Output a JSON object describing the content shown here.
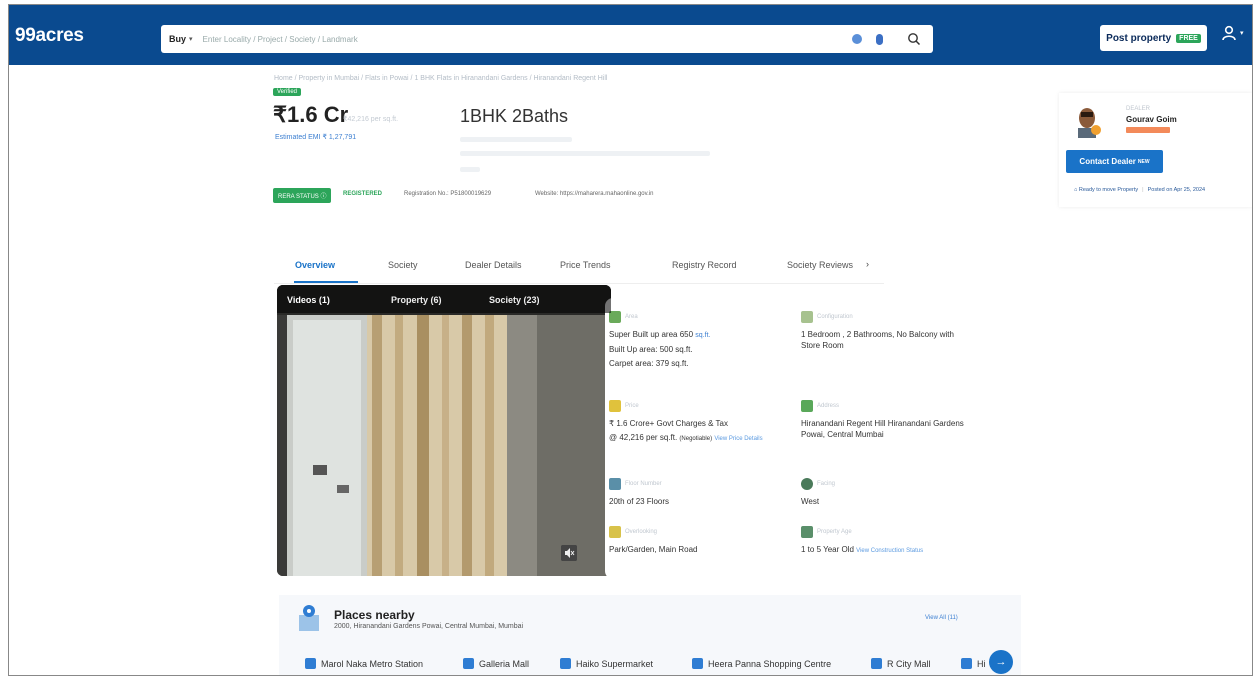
{
  "header": {
    "logo": "99acres",
    "search": {
      "buy_label": "Buy",
      "placeholder": "Enter Locality / Project / Society / Landmark"
    },
    "post_property": "Post property",
    "free_badge": "FREE"
  },
  "breadcrumb": "Home / Property in Mumbai / Flats in Powai / 1 BHK Flats in Hiranandani Gardens / Hiranandani Regent Hill",
  "listing": {
    "verified_badge": "Verified",
    "price": "₹1.6 Cr",
    "price_sub": "₹42,216 per sq.ft.",
    "emi": "Estimated EMI ₹ 1,27,791",
    "bhk_title": "1BHK 2Baths"
  },
  "rera": {
    "status_label": "RERA STATUS",
    "registered": "REGISTERED",
    "registration_no": "Registration No.: P51800019629",
    "website": "Website: https://maharera.mahaonline.gov.in"
  },
  "tabs": {
    "items": [
      "Overview",
      "Society",
      "Dealer Details",
      "Price Trends",
      "Registry Record",
      "Society Reviews"
    ],
    "next": "›"
  },
  "media": {
    "tabs": [
      "Videos (1)",
      "Property (6)",
      "Society (23)"
    ]
  },
  "details": {
    "area": {
      "label": "Area",
      "super": "Super Built up area 650",
      "unit": "sq.ft.",
      "built": "Built Up area: 500 sq.ft.",
      "carpet": "Carpet area: 379 sq.ft."
    },
    "configuration": {
      "label": "Configuration",
      "value": "1 Bedroom , 2 Bathrooms, No Balcony with Store Room"
    },
    "price": {
      "label": "Price",
      "value": "₹ 1.6 Crore+ Govt Charges & Tax",
      "per_sqft": "@ 42,216 per sq.ft.",
      "negotiable": "(Negotiable)",
      "link": "View Price Details"
    },
    "address": {
      "label": "Address",
      "value": "Hiranandani Regent Hill Hiranandani Gardens Powai, Central Mumbai"
    },
    "floor": {
      "label": "Floor Number",
      "value": "20th of 23 Floors"
    },
    "facing": {
      "label": "Facing",
      "value": "West"
    },
    "overlooking": {
      "label": "Overlooking",
      "value": "Park/Garden, Main Road"
    },
    "age": {
      "label": "Property Age",
      "value": "1 to 5 Year Old",
      "link": "View Construction Status"
    }
  },
  "dealer": {
    "role": "DEALER",
    "name": "Gourav Goim",
    "contact_label": "Contact Dealer",
    "contact_sup": "NEW",
    "ready_to_move": "Ready to move Property",
    "posted_on": "Posted on Apr 25, 2024"
  },
  "places": {
    "title": "Places nearby",
    "address": "2000, Hiranandani Gardens Powai, Central Mumbai, Mumbai",
    "view_all": "View All (11)",
    "items": [
      "Marol Naka Metro Station",
      "Galleria Mall",
      "Haiko Supermarket",
      "Heera Panna Shopping Centre",
      "R City Mall",
      "Hi"
    ]
  }
}
